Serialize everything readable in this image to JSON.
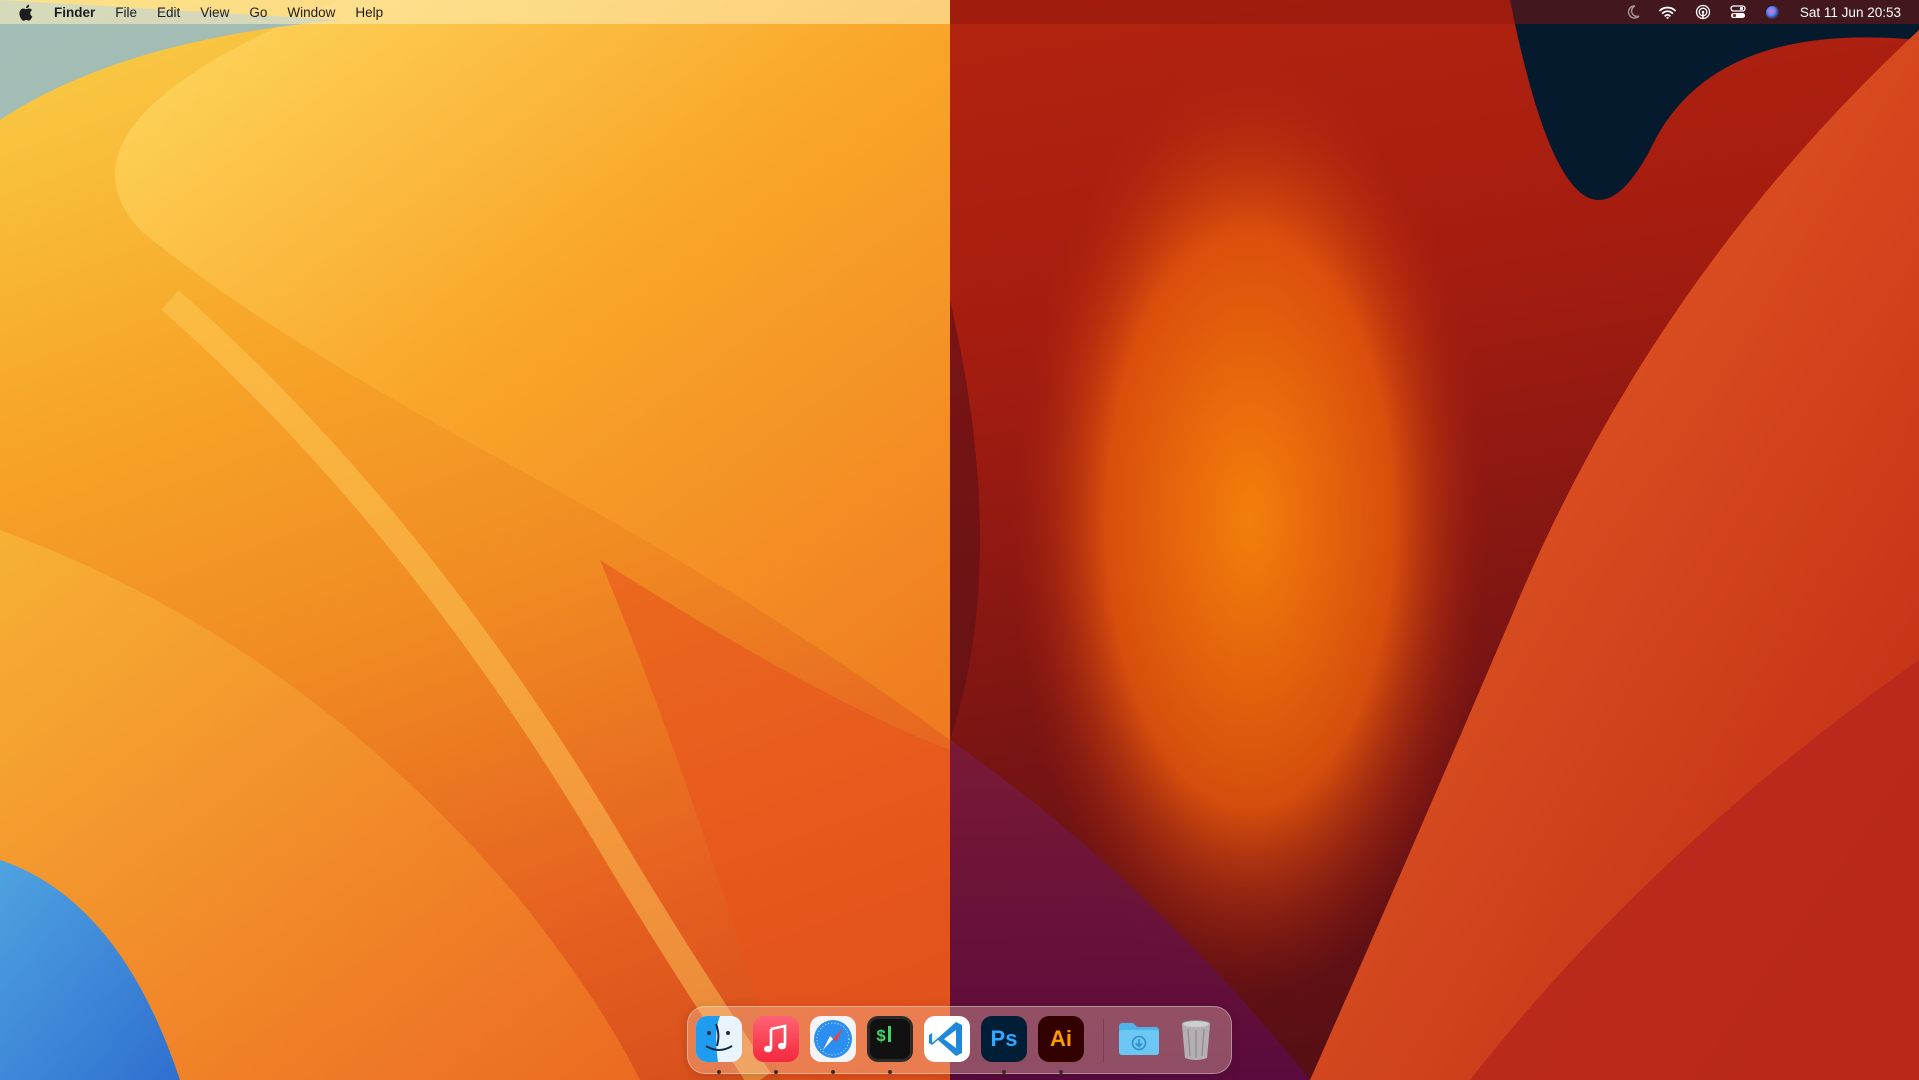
{
  "menubar": {
    "apple_icon": "apple-logo-icon",
    "menus": [
      "Finder",
      "File",
      "Edit",
      "View",
      "Go",
      "Window",
      "Help"
    ],
    "status_icons": [
      "moon-icon",
      "wifi-icon",
      "airdrop-icon",
      "control-center-icon",
      "siri-icon"
    ],
    "clock": "Sat 11 Jun  20:53"
  },
  "dock": {
    "apps": [
      {
        "name": "Finder",
        "icon": "finder-icon",
        "running": true
      },
      {
        "name": "Music",
        "icon": "music-icon",
        "running": true
      },
      {
        "name": "Safari",
        "icon": "safari-icon",
        "running": true
      },
      {
        "name": "Terminal",
        "icon": "terminal-icon",
        "running": true
      },
      {
        "name": "Visual Studio Code",
        "icon": "vscode-icon",
        "running": false
      },
      {
        "name": "Photoshop",
        "icon": "photoshop-icon",
        "running": true,
        "label": "Ps"
      },
      {
        "name": "Illustrator",
        "icon": "illustrator-icon",
        "running": true,
        "label": "Ai"
      }
    ],
    "others": [
      {
        "name": "Downloads",
        "icon": "downloads-folder-icon"
      },
      {
        "name": "Trash",
        "icon": "trash-icon"
      }
    ]
  },
  "colors": {
    "ps_background": "#001e36",
    "ps_text": "#31a8ff",
    "ai_background": "#330000",
    "ai_text": "#ff9a00"
  }
}
